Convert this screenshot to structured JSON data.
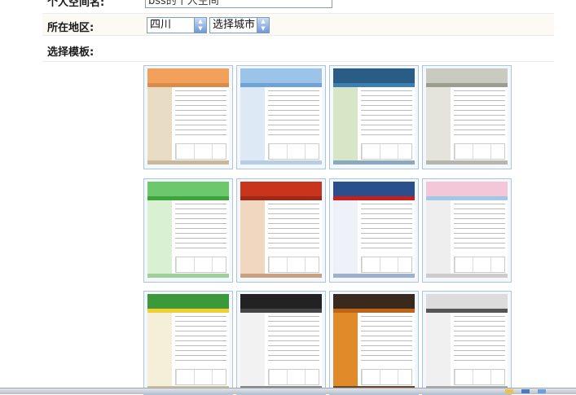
{
  "form": {
    "space_name_label": "个人空间名:",
    "space_name_value": "bss的个人空间",
    "region_label": "所在地区:",
    "province_selected": "四川",
    "city_selected": "选择城市",
    "template_label": "选择模板:"
  },
  "templates": [
    {
      "header": "#f2a05a",
      "nav": "#d98b4a",
      "side": "#e9dcc4",
      "foot": "#c9b89a"
    },
    {
      "header": "#9cc4ea",
      "nav": "#6fa3d6",
      "side": "#dde9f5",
      "foot": "#b7cde3"
    },
    {
      "header": "#2a5d86",
      "nav": "#3c7fb0",
      "side": "#d8e6c8",
      "foot": "#8aa8c0"
    },
    {
      "header": "#c9cbc0",
      "nav": "#9a9d90",
      "side": "#e4e4dc",
      "foot": "#b5b7ac"
    },
    {
      "header": "#6cc86a",
      "nav": "#3da33b",
      "side": "#d9f0d2",
      "foot": "#9ed19a"
    },
    {
      "header": "#c8341c",
      "nav": "#a02818",
      "side": "#f0d8c0",
      "foot": "#c9a080"
    },
    {
      "header": "#2b4f8c",
      "nav": "#c81e1e",
      "side": "#eef2f8",
      "foot": "#9db0cc"
    },
    {
      "header": "#f4c6d8",
      "nav": "#9fc9e6",
      "side": "#eeeeee",
      "foot": "#cccccc"
    },
    {
      "header": "#3a9a3a",
      "nav": "#f0d030",
      "side": "#f4efd8",
      "foot": "#c7c09a"
    },
    {
      "header": "#222222",
      "nav": "#444444",
      "side": "#f2f2f2",
      "foot": "#888888"
    },
    {
      "header": "#3a2a1e",
      "nav": "#c06418",
      "side": "#e08a2a",
      "foot": "#6a4a2a"
    },
    {
      "header": "#dcdcdc",
      "nav": "#555555",
      "side": "#f0f0f0",
      "foot": "#aaaaaa"
    }
  ]
}
